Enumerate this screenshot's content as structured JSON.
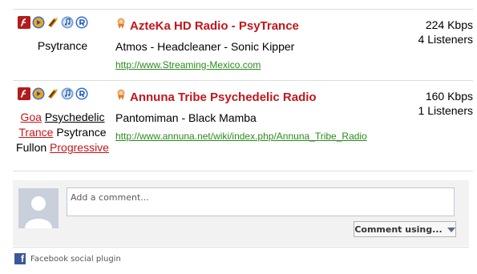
{
  "stations": [
    {
      "title": "AzteKa HD Radio - PsyTrance",
      "track": "Atmos - Headcleaner - Sonic Kipper",
      "url": "http://www.Streaming-Mexico.com",
      "genre_plain": "Psytrance",
      "bitrate": "224 Kbps",
      "listeners": "4 Listeners",
      "player_icons": [
        "flash-player-icon",
        "media-player-icon",
        "winamp-icon",
        "itunes-icon",
        "realplayer-icon"
      ]
    },
    {
      "title": "Annuna Tribe Psychedelic Radio",
      "track": "Pantomiman - Black Mamba",
      "url": "http://www.annuna.net/wiki/index.php/Annuna_Tribe_Radio",
      "genres": {
        "goa": "Goa",
        "psychedelic": "Psychedelic",
        "trance": "Trance",
        "psytrance": "Psytrance",
        "fullon": "Fullon",
        "progressive": "Progressive"
      },
      "bitrate": "160 Kbps",
      "listeners": "1 Listeners",
      "player_icons": [
        "flash-player-icon",
        "media-player-icon",
        "winamp-icon",
        "itunes-icon",
        "realplayer-icon"
      ]
    }
  ],
  "comments": {
    "placeholder": "Add a comment...",
    "button_label": "Comment using...",
    "plugin_label": "Facebook social plugin"
  },
  "colors": {
    "title_red": "#c2161b",
    "link_green": "#2a8a1c",
    "facebook_blue": "#3b5998"
  }
}
